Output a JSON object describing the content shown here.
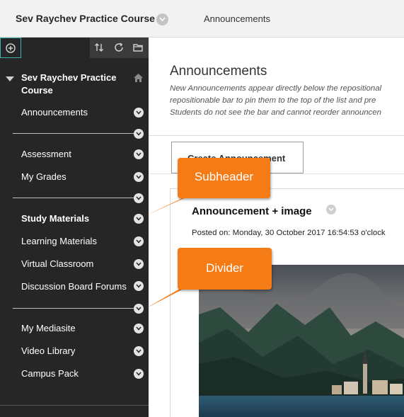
{
  "header": {
    "course_title": "Sev Raychev Practice Course",
    "breadcrumb": "Announcements"
  },
  "sidebar": {
    "course_name": "Sev Raychev Practice Course",
    "items": [
      {
        "label": "Announcements"
      },
      {
        "label": "Assessment"
      },
      {
        "label": "My Grades"
      },
      {
        "label": "Study Materials"
      },
      {
        "label": "Learning Materials"
      },
      {
        "label": "Virtual Classroom"
      },
      {
        "label": "Discussion Board Forums"
      },
      {
        "label": "My Mediasite"
      },
      {
        "label": "Video Library"
      },
      {
        "label": "Campus Pack"
      }
    ]
  },
  "main": {
    "title": "Announcements",
    "help_lines": [
      "New Announcements appear directly below the repositional",
      "repositionable bar to pin them to the top of the list and pre",
      "Students do not see the bar and cannot reorder announcen"
    ],
    "create_button": "Create Announcement",
    "announcement": {
      "title": "Announcement + image",
      "posted": "Posted on: Monday, 30 October 2017 16:54:53 o'clock"
    }
  },
  "callouts": {
    "subheader": "Subheader",
    "divider": "Divider"
  },
  "colors": {
    "sidebar_bg": "#262626",
    "callout": "#f47b16",
    "accent": "#3fb0ac"
  }
}
